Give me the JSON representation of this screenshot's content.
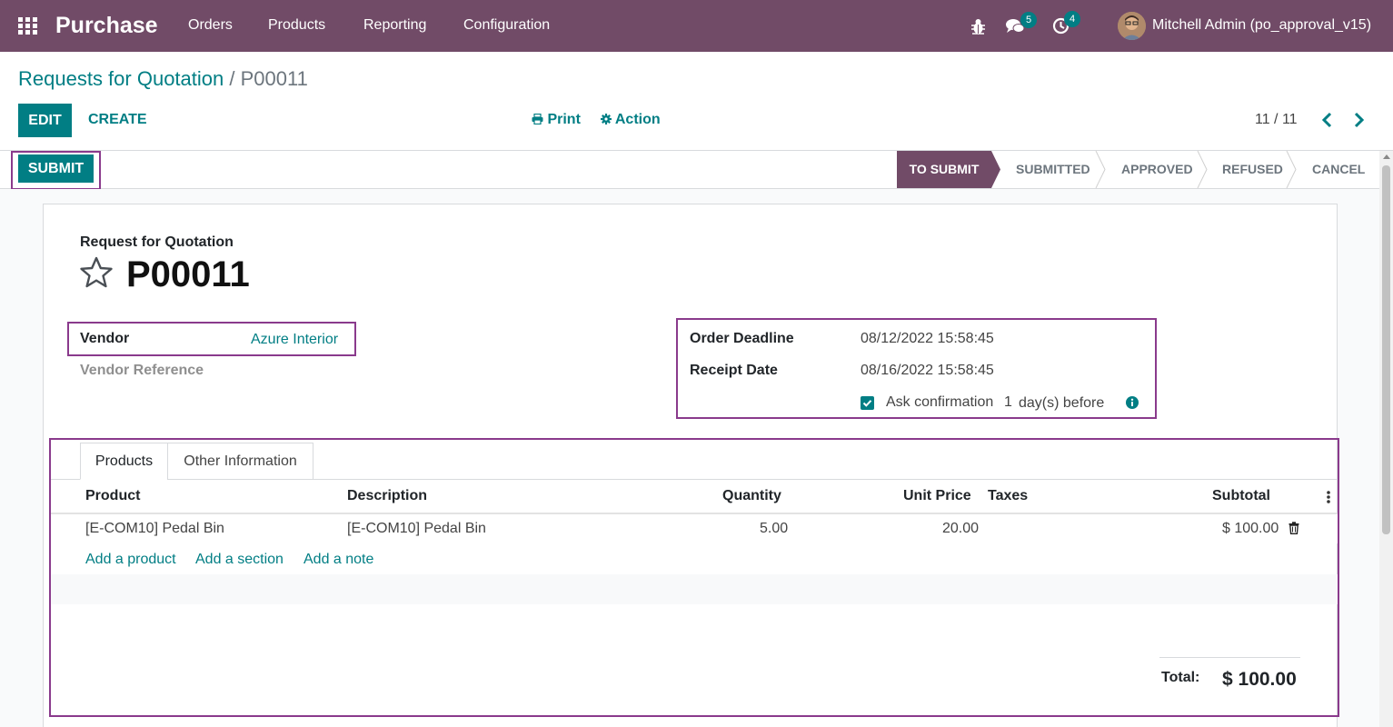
{
  "navbar": {
    "app_name": "Purchase",
    "menus": [
      "Orders",
      "Products",
      "Reporting",
      "Configuration"
    ],
    "icons": [
      "apps-grid-icon",
      "bug-icon",
      "chat-icon",
      "activity-clock-icon"
    ],
    "messages_count": "5",
    "activities_count": "4",
    "user_name": "Mitchell Admin (po_approval_v15)"
  },
  "breadcrumb": {
    "parent": "Requests for Quotation",
    "separator": "/",
    "current": "P00011"
  },
  "control_panel": {
    "edit_label": "EDIT",
    "create_label": "CREATE",
    "print_label": "Print",
    "action_label": "Action",
    "pager": "11 / 11"
  },
  "statusbar": {
    "submit_label": "SUBMIT",
    "stages": [
      "TO SUBMIT",
      "SUBMITTED",
      "APPROVED",
      "REFUSED",
      "CANCEL"
    ],
    "active_stage": "TO SUBMIT"
  },
  "form": {
    "subtitle": "Request for Quotation",
    "name": "P00011",
    "vendor_label": "Vendor",
    "vendor_value": "Azure Interior",
    "vendor_ref_label": "Vendor Reference",
    "order_deadline_label": "Order Deadline",
    "order_deadline_value": "08/12/2022 15:58:45",
    "receipt_date_label": "Receipt Date",
    "receipt_date_value": "08/16/2022 15:58:45",
    "ask_confirmation_label": "Ask confirmation",
    "ask_confirmation_days": "1",
    "days_before_label": "day(s) before",
    "ask_confirmation_checked": true
  },
  "notebook": {
    "tabs": [
      "Products",
      "Other Information"
    ],
    "active_tab": "Products",
    "columns": [
      "Product",
      "Description",
      "Quantity",
      "Unit Price",
      "Taxes",
      "Subtotal"
    ],
    "rows": [
      {
        "product": "[E-COM10] Pedal Bin",
        "description": "[E-COM10] Pedal Bin",
        "quantity": "5.00",
        "unit_price": "20.00",
        "taxes": "",
        "subtotal": "$ 100.00"
      }
    ],
    "add_links": [
      "Add a product",
      "Add a section",
      "Add a note"
    ],
    "total_label": "Total:",
    "total_value": "$ 100.00"
  },
  "colors": {
    "brand": "#714b67",
    "accent": "#017e84",
    "highlight": "#8a3a8c"
  }
}
